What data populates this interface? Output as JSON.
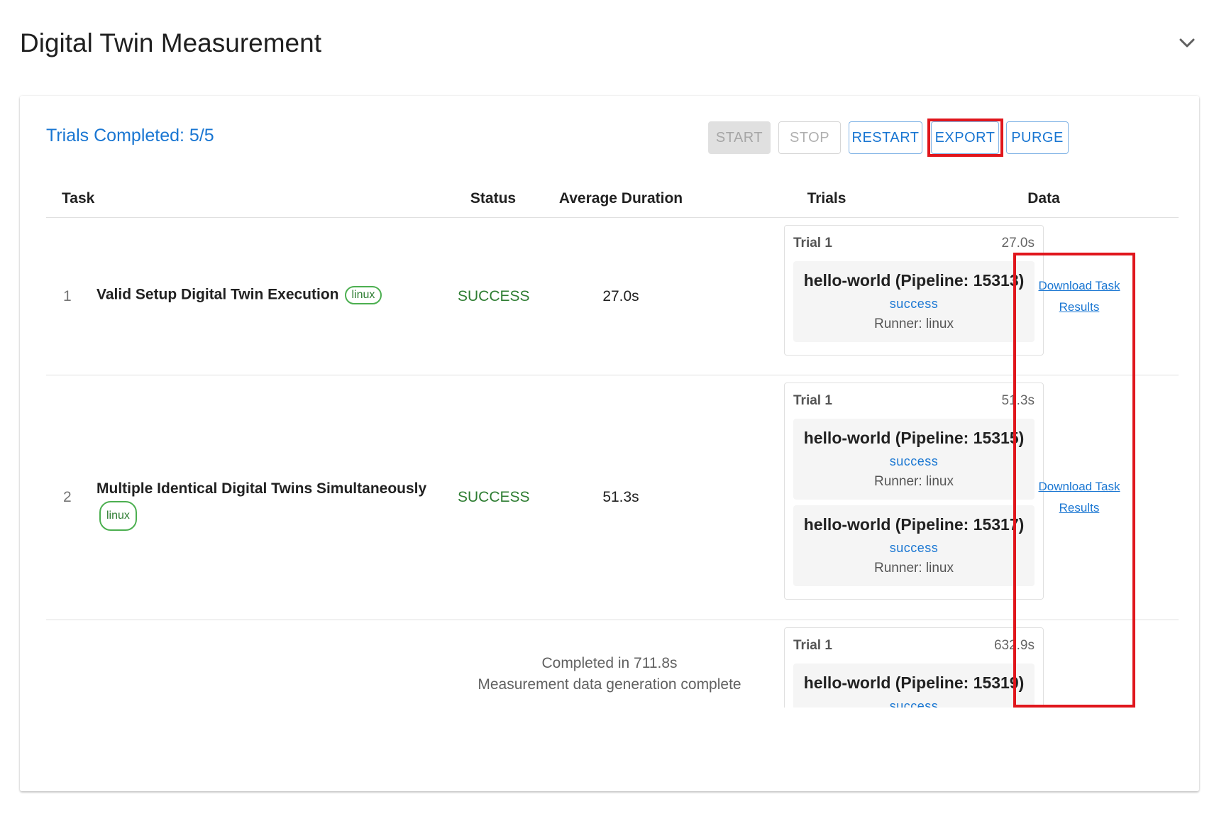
{
  "header": {
    "title": "Digital Twin Measurement"
  },
  "summary": {
    "trials_completed": "Trials Completed: 5/5"
  },
  "toolbar": {
    "start_label": "START",
    "stop_label": "STOP",
    "restart_label": "RESTART",
    "export_label": "EXPORT",
    "purge_label": "PURGE"
  },
  "table": {
    "columns": [
      "Task",
      "Status",
      "Average Duration",
      "Trials",
      "Data"
    ],
    "rows": [
      {
        "index": "1",
        "task": "Valid Setup Digital Twin Execution",
        "chip": "linux",
        "status": "SUCCESS",
        "avg_duration": "27.0s",
        "trial_label": "Trial 1",
        "trial_duration": "27.0s",
        "pipelines": [
          {
            "title": "hello-world (Pipeline: 15313)",
            "status": "success",
            "runner": "Runner: linux"
          }
        ],
        "download_line1": "Download Task",
        "download_line2": "Results"
      },
      {
        "index": "2",
        "task": "Multiple Identical Digital Twins Simultaneously",
        "chip": "linux",
        "status": "SUCCESS",
        "avg_duration": "51.3s",
        "trial_label": "Trial 1",
        "trial_duration": "51.3s",
        "pipelines": [
          {
            "title": "hello-world (Pipeline: 15315)",
            "status": "success",
            "runner": "Runner: linux"
          },
          {
            "title": "hello-world (Pipeline: 15317)",
            "status": "success",
            "runner": "Runner: linux"
          }
        ],
        "download_line1": "Download Task",
        "download_line2": "Results"
      },
      {
        "trial_label": "Trial 1",
        "trial_duration": "632.9s",
        "pipelines": [
          {
            "title": "hello-world (Pipeline: 15319)",
            "status": "success"
          }
        ]
      }
    ]
  },
  "footer": {
    "completed": "Completed in 711.8s",
    "message": "Measurement data generation complete"
  },
  "colors": {
    "accent": "#1976d2",
    "success": "#2e7d32",
    "highlight": "#e0161c"
  }
}
